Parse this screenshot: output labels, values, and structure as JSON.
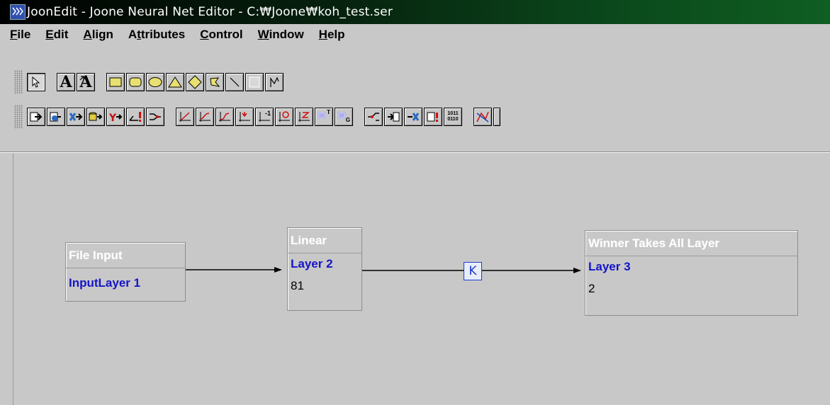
{
  "window": {
    "title": "JoonEdit - Joone Neural Net Editor - C:₩Joone₩koh_test.ser"
  },
  "menu": {
    "items": [
      {
        "pre": "",
        "u": "F",
        "post": "ile"
      },
      {
        "pre": "",
        "u": "E",
        "post": "dit"
      },
      {
        "pre": "",
        "u": "A",
        "post": "lign"
      },
      {
        "pre": "A",
        "u": "t",
        "post": "tributes"
      },
      {
        "pre": "",
        "u": "C",
        "post": "ontrol"
      },
      {
        "pre": "",
        "u": "W",
        "post": "indow"
      },
      {
        "pre": "",
        "u": "H",
        "post": "elp"
      }
    ]
  },
  "toolbar1": {
    "text_tool_labels": [
      "A",
      "A"
    ]
  },
  "toolbar2": {
    "icon_labels": [
      "-1",
      "T",
      "G",
      "1011",
      "0110"
    ]
  },
  "layers": {
    "file_input": {
      "header": "File Input",
      "name": "InputLayer 1"
    },
    "linear": {
      "header": "Linear",
      "name": "Layer 2",
      "value": "81"
    },
    "wta": {
      "header": "Winner Takes All Layer",
      "name": "Layer 3",
      "value": "2"
    }
  },
  "synapse": {
    "label": "K"
  },
  "colors": {
    "background": "#c8c8c8",
    "layer_name": "#1414c8",
    "synapse": "#1e3ad0",
    "title_gradient_end": "#0f5e22"
  }
}
